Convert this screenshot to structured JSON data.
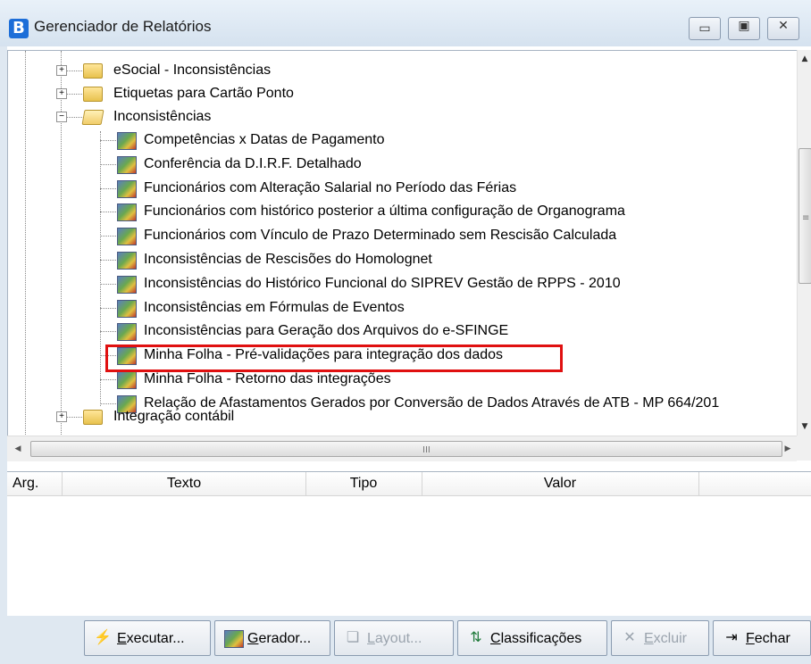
{
  "window": {
    "app_icon_letter": "B",
    "title": "Gerenciador de Relatórios",
    "controls": {
      "minimize": "▭",
      "maximize": "▣",
      "close": "✕"
    }
  },
  "tree": {
    "top_folders": [
      {
        "label": "eSocial - Inconsistências",
        "expander": "+"
      },
      {
        "label": "Etiquetas para Cartão Ponto",
        "expander": "+"
      }
    ],
    "open_folder": {
      "label": "Inconsistências",
      "expander": "−"
    },
    "reports": [
      "Competências x Datas de Pagamento",
      "Conferência da D.I.R.F. Detalhado",
      "Funcionários com Alteração Salarial no Período das Férias",
      "Funcionários com histórico posterior a última configuração de Organograma",
      "Funcionários com Vínculo de Prazo Determinado sem Rescisão Calculada",
      "Inconsistências de Rescisões do Homolognet",
      "Inconsistências do Histórico Funcional do SIPREV Gestão de RPPS - 2010",
      "Inconsistências em Fórmulas de Eventos",
      "Inconsistências para Geração dos Arquivos do e-SFINGE",
      "Minha Folha - Pré-validações para integração dos dados",
      "Minha Folha - Retorno das integrações",
      "Relação de Afastamentos Gerados por Conversão de Dados Através de ATB - MP 664/201"
    ],
    "selected_report_index": 9,
    "bottom_folder": {
      "label": "Integração contábil",
      "expander": "+"
    }
  },
  "scrollbars": {
    "grip": "III",
    "up": "▲",
    "down": "▼",
    "left": "◀",
    "right": "▶"
  },
  "args_table": {
    "columns": [
      "Arg.",
      "Texto",
      "Tipo",
      "Valor"
    ]
  },
  "toolbar": {
    "buttons": [
      {
        "icon": "lightning-icon",
        "glyph": "⚡",
        "underline": "E",
        "rest": "xecutar...",
        "enabled": true
      },
      {
        "icon": "report-generator-icon",
        "glyph": "",
        "underline": "G",
        "rest": "erador...",
        "enabled": true
      },
      {
        "icon": "layout-icon",
        "glyph": "❏",
        "underline": "L",
        "rest": "ayout...",
        "enabled": false
      },
      {
        "icon": "classifications-icon",
        "glyph": "⇅",
        "underline": "C",
        "rest": "lassificações",
        "enabled": true
      },
      {
        "icon": "delete-icon",
        "glyph": "✕",
        "underline": "E",
        "rest": "xcluir",
        "enabled": false
      },
      {
        "icon": "exit-door-icon",
        "glyph": "⇥",
        "underline": "F",
        "rest": "echar",
        "enabled": true
      }
    ]
  }
}
